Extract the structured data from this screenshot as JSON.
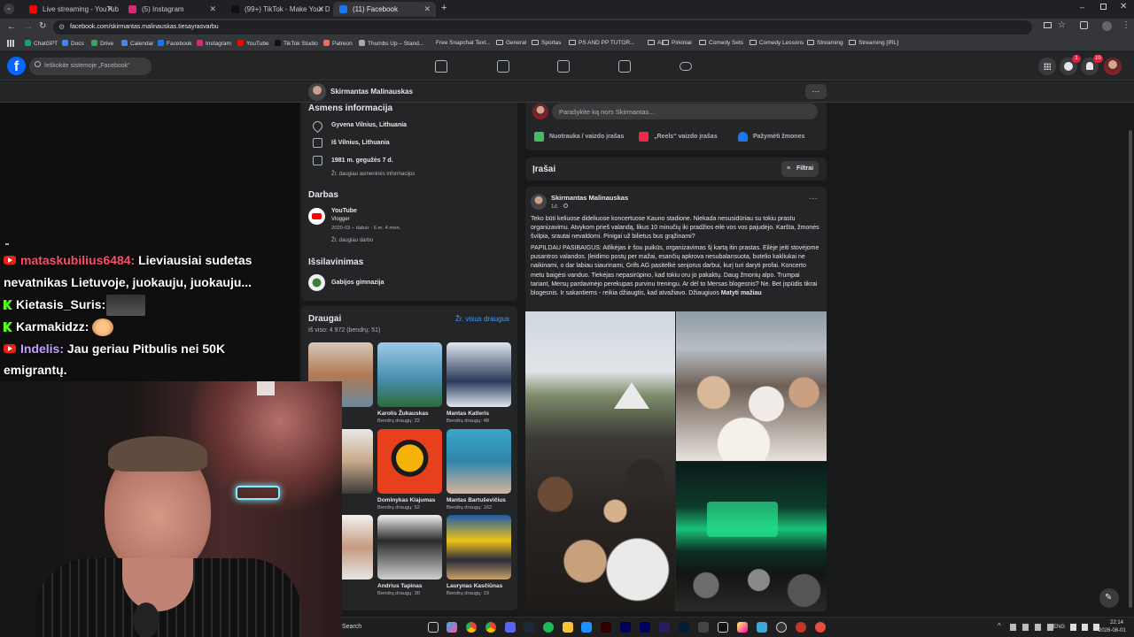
{
  "browser": {
    "tabs": [
      {
        "title": "Live streaming - YouTube Studio",
        "color": "#ff0000"
      },
      {
        "title": "(5) Instagram",
        "color": "#d62976"
      },
      {
        "title": "(99+) TikTok - Make Your Day",
        "color": "#111111"
      },
      {
        "title": "(11) Facebook",
        "color": "#1877f2"
      }
    ],
    "url": "facebook.com/skirmantas.malinauskas.tiesayrasvarbu",
    "bookmarks": [
      "ChatGPT",
      "Docs",
      "Drive",
      "Calendar",
      "Facebook",
      "Instagram",
      "YouTube",
      "TikTok Studio",
      "Patreon",
      "Thumbs Up – Stand...",
      "Free Snapchat Text...",
      "General",
      "Sportas",
      "PS AND PP TUTOR...",
      "AJ",
      "Pirkiniai",
      "Comedy Sets",
      "Comedy Lessons",
      "Streaming",
      "Streaming [IRL]"
    ]
  },
  "fb": {
    "search_placeholder": "Ieškokite sistemoje „Facebook“",
    "messenger_badge": "1",
    "notif_badge": "10",
    "profile_name": "Skirmantas Malinauskas",
    "about": {
      "heading": "Asmens informacija",
      "lives": "Gyvena Vilnius, Lithuania",
      "from": "Iš Vilnius, Lithuania",
      "born": "1981 m. gegužės 7 d.",
      "more_personal": "Žr. daugiau asmeninės informacijos"
    },
    "work": {
      "heading": "Darbas",
      "company": "YouTube",
      "role": "Vlogger",
      "period": "2020-03 – dabar · 6 m. 4 mėn.",
      "more": "Žr. daugiau darbo"
    },
    "education": {
      "heading": "Išsilavinimas",
      "school": "Gabijos gimnazija"
    },
    "friends": {
      "heading": "Draugai",
      "see_all": "Žr. visus draugus",
      "count": "Iš viso: 4 972 (bendrų: 51)",
      "items": [
        {
          "name": "...ubaitis",
          "mutual": "...gų: 67"
        },
        {
          "name": "Karolis Žukauskas",
          "mutual": "Bendrų draugų: 22"
        },
        {
          "name": "Mantas Katleris",
          "mutual": "Bendrų draugų: 48"
        },
        {
          "name": "...kas",
          "mutual": "...gų: 138"
        },
        {
          "name": "Dominykas Klajumas",
          "mutual": "Bendrų draugų: 52"
        },
        {
          "name": "Mantas Bartuševičius",
          "mutual": "Bendrų draugų: 162"
        },
        {
          "name": "...uskas",
          "mutual": "...gų: 94"
        },
        {
          "name": "Andrius Tapinas",
          "mutual": "Bendrų draugų: 30"
        },
        {
          "name": "Laurynas Kasčiūnas",
          "mutual": "Bendrų draugų: 19"
        }
      ]
    },
    "composer": {
      "placeholder": "Parašykite ką nors Skirmantas...",
      "photo": "Nuotrauka / vaizdo įrašas",
      "reels": "„Reels“ vaizdo įrašas",
      "tag": "Pažymėti žmones"
    },
    "posts_heading": "Įrašai",
    "filters": "Filtrai",
    "post": {
      "author": "Skirmantas Malinauskas",
      "time": "1d. · ",
      "p1": "Teko būti keliuose dideliuose koncertuose Kauno stadione. Niekada nesusidūriau su tokiu prastu organizavimu. Atvykom prieš valandą, likus 10 minučių iki pradžios eilė vos vos pajudėjo. Karšta, žmonės švilpia, srautai nevaldomi. Pinigai už bilietus bus grąžinami?",
      "p2": "PAPILDAU PASIBAIGUS: Atlikėjas ir šou puikūs, organizavimas šį kartą itin prastas. Eilėje jeiti stovėjome pusantros valandos. Įleidimo postų per mažai, esančių apkrova nesubalansuota, butelio kakliukai ne naikinami, o dar labiau siaurinami, Grifs AG pasitelkė senjorus darbui, kurį turi daryti profai. Koncerto metu baigėsi vanduo. Tiekėjas nepasirūpino, kad tokiu oru jo pakaktų. Daug žmonių alpo. Trumpai tariant, Mersų pardavinėjo perekupas purvinu treningu. Ar dėl to Mersas blogesnis? Ne. Bet įspūdis tikrai blogesnis. Ir sakantiems - reikia džiaugtis, kad atvažiavo. Džiaugiuos",
      "see_more": "Matyti mažiau"
    }
  },
  "chat": [
    {
      "platform": "yt",
      "user": "mataskubilius6484:",
      "user_color": "#ff4d6d",
      "text": "Lieviausiai sudetas"
    },
    {
      "platform": "",
      "user": "",
      "user_color": "#ffffff",
      "text": "nevatnikas Lietuvoje, juokauju, juokauju..."
    },
    {
      "platform": "kick",
      "user": "Kietasis_Suris:",
      "user_color": "#ffffff",
      "text": ""
    },
    {
      "platform": "kick",
      "user": "Karmakidzz:",
      "user_color": "#ffffff",
      "text": ""
    },
    {
      "platform": "yt",
      "user": "Indelis:",
      "user_color": "#c9a0ff",
      "text": "Jau geriau Pitbulis nei 50K"
    },
    {
      "platform": "",
      "user": "",
      "user_color": "#ffffff",
      "text": "emigrantų."
    }
  ],
  "taskbar": {
    "search": "Search",
    "lang": "ENG",
    "time": "22:14",
    "date": "2026-08-01"
  }
}
